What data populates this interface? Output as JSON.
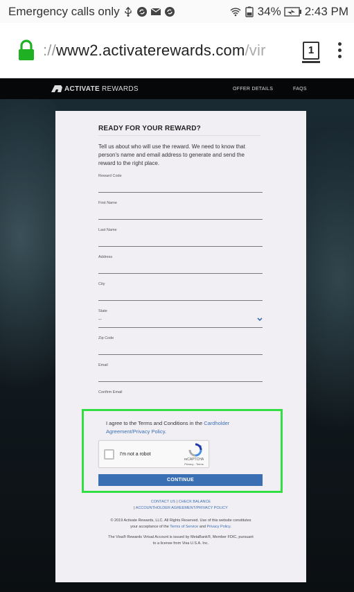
{
  "status_bar": {
    "left_text": "Emergency calls only",
    "battery": "34%",
    "time": "2:43 PM"
  },
  "browser": {
    "url_scheme": "://",
    "url_host": "www2.activaterewards.com",
    "url_tail": "/vir",
    "tab_count": "1"
  },
  "site": {
    "logo_bold": "ACTIVATE",
    "logo_rest": " REWARDS",
    "nav": [
      "OFFER DETAILS",
      "FAQS"
    ]
  },
  "form": {
    "title": "READY FOR YOUR REWARD?",
    "intro": "Tell us about who will use the reward. We need to know that person's name and email address to generate and send the reward to the right place.",
    "fields": {
      "reward_code": "Reward Code",
      "first_name": "First Name",
      "last_name": "Last Name",
      "address": "Address",
      "city": "City",
      "state": "State",
      "state_value": "--",
      "zip_code": "Zip Code",
      "email": "Email",
      "confirm_email": "Confirm Email"
    },
    "agree_text": "I agree to the Terms and Conditions in the ",
    "agree_link": "Cardholder Agreement/Privacy Policy",
    "agree_end": ".",
    "recaptcha": {
      "label": "I'm not a robot",
      "brand": "reCAPTCHA",
      "terms": "Privacy - Terms"
    },
    "continue_label": "CONTINUE"
  },
  "footer": {
    "contact": "CONTACT US",
    "sep1": " | ",
    "balance": "CHECK BALANCE",
    "sep2": "| ",
    "agreement": "ACCOUNTHOLDER AGREEMENT/PRIVACY POLICY",
    "copyright_1": "© 2019 Activate Rewards, LLC. All Rights Reserved. Use of this website constitutes",
    "copyright_2a": "your acceptance of the ",
    "terms_link": "Terms of Service",
    "copyright_2b": " and ",
    "privacy_link": "Privacy Policy",
    "copyright_2c": ".",
    "visa_1": "The Visa® Rewards Virtual Account is issued by MetaBank®, Member FDIC, pursuant",
    "visa_2": "to a license from Visa U.S.A. Inc."
  },
  "colors": {
    "highlight": "#33dd44",
    "button": "#3a6fb4",
    "link": "#3b6fb6",
    "lock": "#1fb024"
  },
  "icons": [
    "usb-icon",
    "sync-icon",
    "mail-icon",
    "sync-icon",
    "wifi-icon",
    "battery-icon",
    "lock-icon",
    "tab-switcher-icon",
    "menu-icon",
    "chevron-down-icon",
    "recaptcha-icon"
  ]
}
